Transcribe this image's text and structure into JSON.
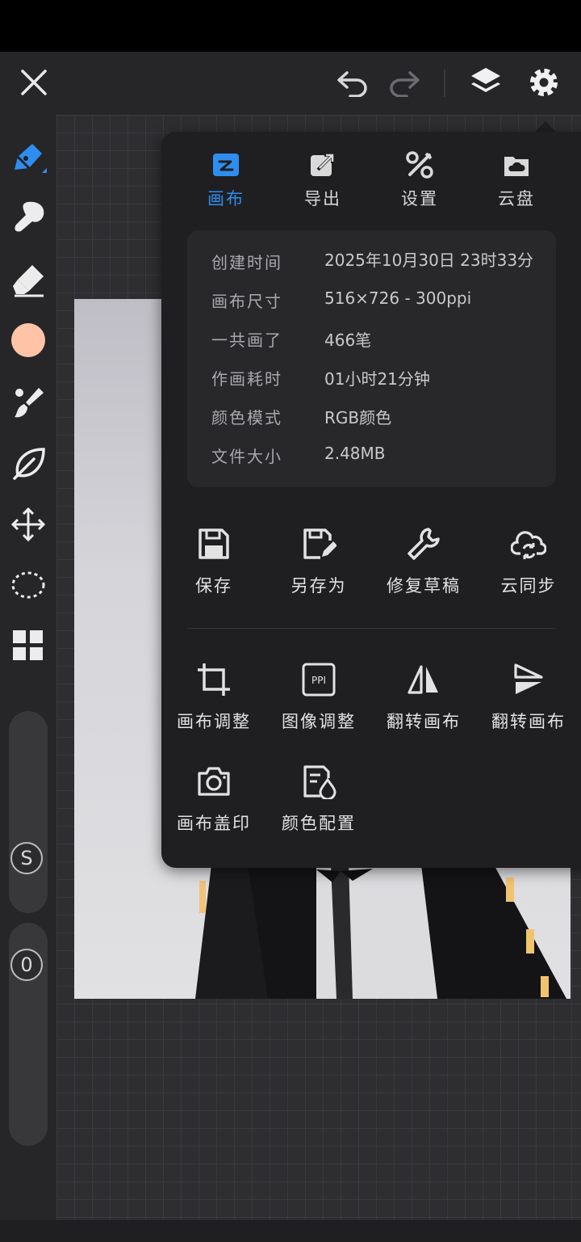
{
  "panel": {
    "tabs": [
      {
        "label": "画布",
        "icon": "canvas-icon",
        "active": true
      },
      {
        "label": "导出",
        "icon": "export-icon",
        "active": false
      },
      {
        "label": "设置",
        "icon": "tools-icon",
        "active": false
      },
      {
        "label": "云盘",
        "icon": "cloud-drive-icon",
        "active": false
      }
    ],
    "info": [
      {
        "key": "创建时间",
        "value": "2025年10月30日 23时33分"
      },
      {
        "key": "画布尺寸",
        "value": "516×726 - 300ppi"
      },
      {
        "key": "一共画了",
        "value": "466笔"
      },
      {
        "key": "作画耗时",
        "value": "01小时21分钟"
      },
      {
        "key": "颜色模式",
        "value": "RGB颜色"
      },
      {
        "key": "文件大小",
        "value": "2.48MB"
      }
    ],
    "actions_row1": [
      {
        "label": "保存",
        "icon": "save-icon"
      },
      {
        "label": "另存为",
        "icon": "save-as-icon"
      },
      {
        "label": "修复草稿",
        "icon": "wrench-icon"
      },
      {
        "label": "云同步",
        "icon": "cloud-sync-icon"
      }
    ],
    "actions_row2": [
      {
        "label": "画布调整",
        "icon": "crop-icon"
      },
      {
        "label": "图像调整",
        "icon": "ppi-icon"
      },
      {
        "label": "翻转画布",
        "icon": "flip-horizontal-icon"
      },
      {
        "label": "翻转画布",
        "icon": "flip-vertical-icon"
      }
    ],
    "actions_row3": [
      {
        "label": "画布盖印",
        "icon": "camera-icon"
      },
      {
        "label": "颜色配置",
        "icon": "color-config-icon"
      }
    ]
  },
  "sidebar": {
    "current_color": "#ffc4a8",
    "size_slider_label": "S",
    "opacity_slider_label": "0"
  },
  "colors": {
    "accent": "#2e8ef0",
    "panel_bg": "#1f1f21"
  }
}
